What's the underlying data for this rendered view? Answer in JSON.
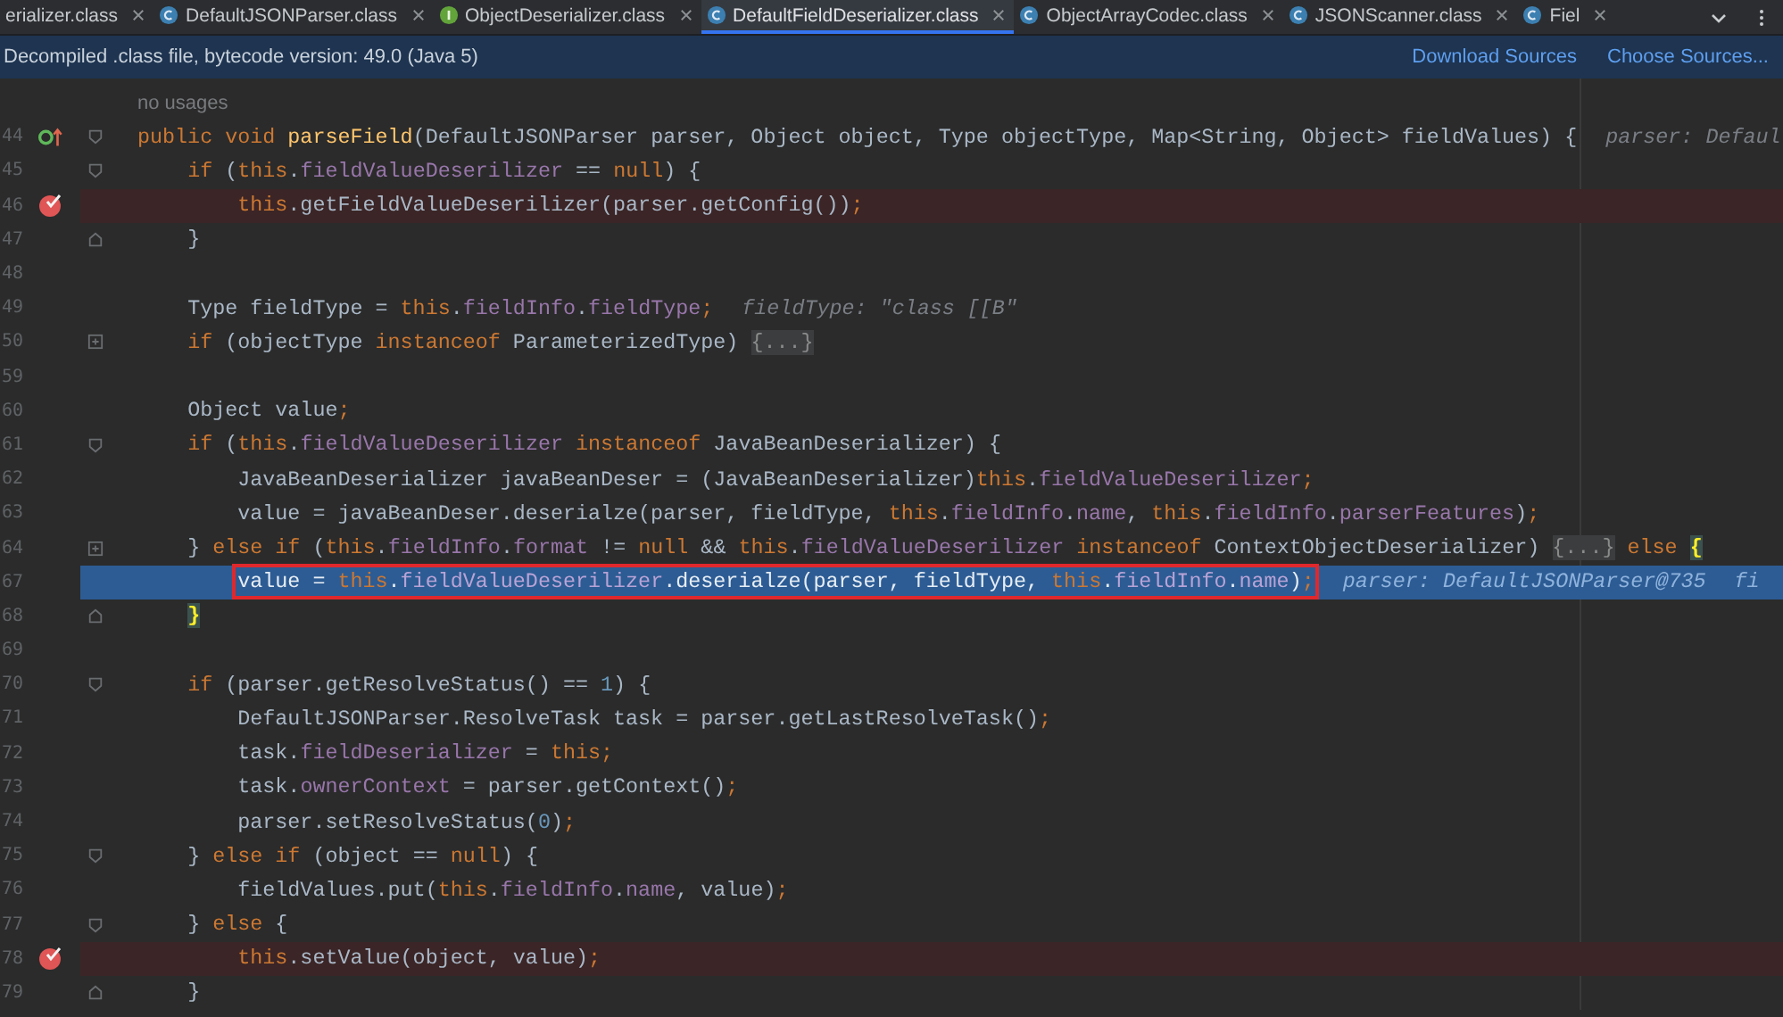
{
  "tabs": [
    {
      "label": "erializer.class",
      "selected": false
    },
    {
      "label": "DefaultJSONParser.class",
      "kind": "class",
      "selected": false
    },
    {
      "label": "ObjectDeserializer.class",
      "kind": "interface",
      "selected": false
    },
    {
      "label": "DefaultFieldDeserializer.class",
      "kind": "class",
      "selected": true
    },
    {
      "label": "ObjectArrayCodec.class",
      "kind": "class",
      "selected": false
    },
    {
      "label": "JSONScanner.class",
      "kind": "class",
      "selected": false
    },
    {
      "label": "Fiel",
      "kind": "class",
      "selected": false
    }
  ],
  "banner": {
    "message": "Decompiled .class file, bytecode version: 49.0 (Java 5)",
    "links": [
      "Download Sources",
      "Choose Sources..."
    ]
  },
  "usages_hint": "no usages",
  "lines": [
    {
      "number": "44",
      "kind": "normal",
      "gutter": [
        {
          "kind": "override"
        },
        {
          "kind": "fold_start"
        }
      ],
      "code": [
        {
          "kind": "kw",
          "text": "public void "
        },
        {
          "kind": "method",
          "text": "parseField"
        },
        {
          "kind": "plain",
          "text": "(DefaultJSONParser parser, Object object, Type objectType, Map<String, Object> fieldValues) {"
        }
      ],
      "hints": [
        "parser: Defaul"
      ]
    },
    {
      "number": "45",
      "kind": "normal",
      "gutter": [
        {
          "kind": "fold_start"
        }
      ],
      "code": [
        {
          "kind": "kw",
          "text": "    if"
        },
        {
          "kind": "plain",
          "text": " ("
        },
        {
          "kind": "kw",
          "text": "this"
        },
        {
          "kind": "plain",
          "text": "."
        },
        {
          "kind": "field",
          "text": "fieldValueDeserilizer"
        },
        {
          "kind": "plain",
          "text": " == "
        },
        {
          "kind": "kw",
          "text": "null"
        },
        {
          "kind": "plain",
          "text": ") {"
        }
      ]
    },
    {
      "number": "46",
      "kind": "breakpoint",
      "gutter": [
        {
          "kind": "breakpoint"
        }
      ],
      "code": [
        {
          "kind": "kw",
          "text": "        this"
        },
        {
          "kind": "plain",
          "text": ".getFieldValueDeserilizer(parser.getConfig())"
        },
        {
          "kind": "kw",
          "text": ";"
        }
      ]
    },
    {
      "number": "47",
      "kind": "normal",
      "gutter": [
        {
          "kind": "fold_end"
        }
      ],
      "code": [
        {
          "kind": "plain",
          "text": "    }"
        }
      ]
    },
    {
      "number": "48",
      "kind": "normal"
    },
    {
      "number": "49",
      "kind": "normal",
      "code": [
        {
          "kind": "plain",
          "text": "    Type fieldType = "
        },
        {
          "kind": "kw",
          "text": "this"
        },
        {
          "kind": "plain",
          "text": "."
        },
        {
          "kind": "field",
          "text": "fieldInfo"
        },
        {
          "kind": "plain",
          "text": "."
        },
        {
          "kind": "field",
          "text": "fieldType"
        },
        {
          "kind": "kw",
          "text": ";"
        }
      ],
      "hints": [
        "fieldType: \"class [[B\""
      ]
    },
    {
      "number": "50",
      "kind": "normal",
      "gutter": [
        {
          "kind": "fold_collapsed"
        }
      ],
      "code": [
        {
          "kind": "kw",
          "text": "    if"
        },
        {
          "kind": "plain",
          "text": " (objectType "
        },
        {
          "kind": "kw",
          "text": "instanceof"
        },
        {
          "kind": "plain",
          "text": " ParameterizedType) "
        },
        {
          "kind": "folded",
          "text": "{...}"
        }
      ]
    },
    {
      "number": "59",
      "kind": "normal"
    },
    {
      "number": "60",
      "kind": "normal",
      "code": [
        {
          "kind": "plain",
          "text": "    Object value"
        },
        {
          "kind": "kw",
          "text": ";"
        }
      ]
    },
    {
      "number": "61",
      "kind": "normal",
      "gutter": [
        {
          "kind": "fold_start"
        }
      ],
      "code": [
        {
          "kind": "kw",
          "text": "    if"
        },
        {
          "kind": "plain",
          "text": " ("
        },
        {
          "kind": "kw",
          "text": "this"
        },
        {
          "kind": "plain",
          "text": "."
        },
        {
          "kind": "field",
          "text": "fieldValueDeserilizer"
        },
        {
          "kind": "kw",
          "text": " instanceof"
        },
        {
          "kind": "plain",
          "text": " JavaBeanDeserializer) {"
        }
      ]
    },
    {
      "number": "62",
      "kind": "normal",
      "code": [
        {
          "kind": "plain",
          "text": "        JavaBeanDeserializer javaBeanDeser = (JavaBeanDeserializer)"
        },
        {
          "kind": "kw",
          "text": "this"
        },
        {
          "kind": "plain",
          "text": "."
        },
        {
          "kind": "field",
          "text": "fieldValueDeserilizer"
        },
        {
          "kind": "kw",
          "text": ";"
        }
      ]
    },
    {
      "number": "63",
      "kind": "normal",
      "code": [
        {
          "kind": "plain",
          "text": "        value = javaBeanDeser.deserialze(parser, fieldType, "
        },
        {
          "kind": "kw",
          "text": "this"
        },
        {
          "kind": "plain",
          "text": "."
        },
        {
          "kind": "field",
          "text": "fieldInfo"
        },
        {
          "kind": "plain",
          "text": "."
        },
        {
          "kind": "field",
          "text": "name"
        },
        {
          "kind": "plain",
          "text": ", "
        },
        {
          "kind": "kw",
          "text": "this"
        },
        {
          "kind": "plain",
          "text": "."
        },
        {
          "kind": "field",
          "text": "fieldInfo"
        },
        {
          "kind": "plain",
          "text": "."
        },
        {
          "kind": "field",
          "text": "parserFeatures"
        },
        {
          "kind": "plain",
          "text": ")"
        },
        {
          "kind": "kw",
          "text": ";"
        }
      ]
    },
    {
      "number": "64",
      "kind": "normal",
      "gutter": [
        {
          "kind": "fold_collapsed"
        }
      ],
      "code": [
        {
          "kind": "plain",
          "text": "    } "
        },
        {
          "kind": "kw",
          "text": "else if"
        },
        {
          "kind": "plain",
          "text": " ("
        },
        {
          "kind": "kw",
          "text": "this"
        },
        {
          "kind": "plain",
          "text": "."
        },
        {
          "kind": "field",
          "text": "fieldInfo"
        },
        {
          "kind": "plain",
          "text": "."
        },
        {
          "kind": "field",
          "text": "format"
        },
        {
          "kind": "plain",
          "text": " != "
        },
        {
          "kind": "kw",
          "text": "null"
        },
        {
          "kind": "plain",
          "text": " && "
        },
        {
          "kind": "kw",
          "text": "this"
        },
        {
          "kind": "plain",
          "text": "."
        },
        {
          "kind": "field",
          "text": "fieldValueDeserilizer"
        },
        {
          "kind": "kw",
          "text": " instanceof"
        },
        {
          "kind": "plain",
          "text": " ContextObjectDeserializer) "
        },
        {
          "kind": "folded",
          "text": "{...}"
        },
        {
          "kind": "kw",
          "text": " else "
        },
        {
          "kind": "match",
          "text": "{"
        }
      ]
    },
    {
      "number": "67",
      "kind": "current",
      "marked_code": [
        {
          "kind": "plain",
          "text": "        value = "
        },
        {
          "kind": "kw",
          "text": "this"
        },
        {
          "kind": "plain",
          "text": "."
        },
        {
          "kind": "field",
          "text": "fieldValueDeserilizer"
        },
        {
          "kind": "plain",
          "text": ".deserialze(parser, fieldType, "
        },
        {
          "kind": "kw",
          "text": "this"
        },
        {
          "kind": "plain",
          "text": "."
        },
        {
          "kind": "field",
          "text": "fieldInfo"
        },
        {
          "kind": "plain",
          "text": "."
        },
        {
          "kind": "field",
          "text": "name"
        },
        {
          "kind": "plain",
          "text": ")"
        },
        {
          "kind": "kw",
          "text": ";"
        }
      ],
      "hints": [
        "parser: DefaultJSONParser@735",
        "fi"
      ]
    },
    {
      "number": "68",
      "kind": "normal",
      "gutter": [
        {
          "kind": "fold_end"
        }
      ],
      "code": [
        {
          "kind": "match",
          "text": "    }"
        }
      ]
    },
    {
      "number": "69",
      "kind": "normal"
    },
    {
      "number": "70",
      "kind": "normal",
      "gutter": [
        {
          "kind": "fold_start"
        }
      ],
      "code": [
        {
          "kind": "kw",
          "text": "    if"
        },
        {
          "kind": "plain",
          "text": " (parser.getResolveStatus() == "
        },
        {
          "kind": "num",
          "text": "1"
        },
        {
          "kind": "plain",
          "text": ") {"
        }
      ]
    },
    {
      "number": "71",
      "kind": "normal",
      "code": [
        {
          "kind": "plain",
          "text": "        DefaultJSONParser.ResolveTask task = parser.getLastResolveTask()"
        },
        {
          "kind": "kw",
          "text": ";"
        }
      ]
    },
    {
      "number": "72",
      "kind": "normal",
      "code": [
        {
          "kind": "plain",
          "text": "        task."
        },
        {
          "kind": "field",
          "text": "fieldDeserializer"
        },
        {
          "kind": "plain",
          "text": " = "
        },
        {
          "kind": "kw",
          "text": "this;"
        }
      ]
    },
    {
      "number": "73",
      "kind": "normal",
      "code": [
        {
          "kind": "plain",
          "text": "        task."
        },
        {
          "kind": "field",
          "text": "ownerContext"
        },
        {
          "kind": "plain",
          "text": " = parser.getContext()"
        },
        {
          "kind": "kw",
          "text": ";"
        }
      ]
    },
    {
      "number": "74",
      "kind": "normal",
      "code": [
        {
          "kind": "plain",
          "text": "        parser.setResolveStatus("
        },
        {
          "kind": "num",
          "text": "0"
        },
        {
          "kind": "plain",
          "text": ")"
        },
        {
          "kind": "kw",
          "text": ";"
        }
      ]
    },
    {
      "number": "75",
      "kind": "normal",
      "gutter": [
        {
          "kind": "fold_start"
        }
      ],
      "code": [
        {
          "kind": "plain",
          "text": "    } "
        },
        {
          "kind": "kw",
          "text": "else if"
        },
        {
          "kind": "plain",
          "text": " (object == "
        },
        {
          "kind": "kw",
          "text": "null"
        },
        {
          "kind": "plain",
          "text": ") {"
        }
      ]
    },
    {
      "number": "76",
      "kind": "normal",
      "code": [
        {
          "kind": "plain",
          "text": "        fieldValues.put("
        },
        {
          "kind": "kw",
          "text": "this"
        },
        {
          "kind": "plain",
          "text": "."
        },
        {
          "kind": "field",
          "text": "fieldInfo"
        },
        {
          "kind": "plain",
          "text": "."
        },
        {
          "kind": "field",
          "text": "name"
        },
        {
          "kind": "plain",
          "text": ", value)"
        },
        {
          "kind": "kw",
          "text": ";"
        }
      ]
    },
    {
      "number": "77",
      "kind": "normal",
      "gutter": [
        {
          "kind": "fold_start"
        }
      ],
      "code": [
        {
          "kind": "plain",
          "text": "    } "
        },
        {
          "kind": "kw",
          "text": "else"
        },
        {
          "kind": "plain",
          "text": " {"
        }
      ]
    },
    {
      "number": "78",
      "kind": "breakpoint",
      "gutter": [
        {
          "kind": "breakpoint"
        }
      ],
      "code": [
        {
          "kind": "kw",
          "text": "        this"
        },
        {
          "kind": "plain",
          "text": ".setValue(object, value)"
        },
        {
          "kind": "kw",
          "text": ";"
        }
      ]
    },
    {
      "number": "79",
      "kind": "normal",
      "gutter": [
        {
          "kind": "fold_end"
        }
      ],
      "code": [
        {
          "kind": "plain",
          "text": "    }"
        }
      ]
    }
  ]
}
